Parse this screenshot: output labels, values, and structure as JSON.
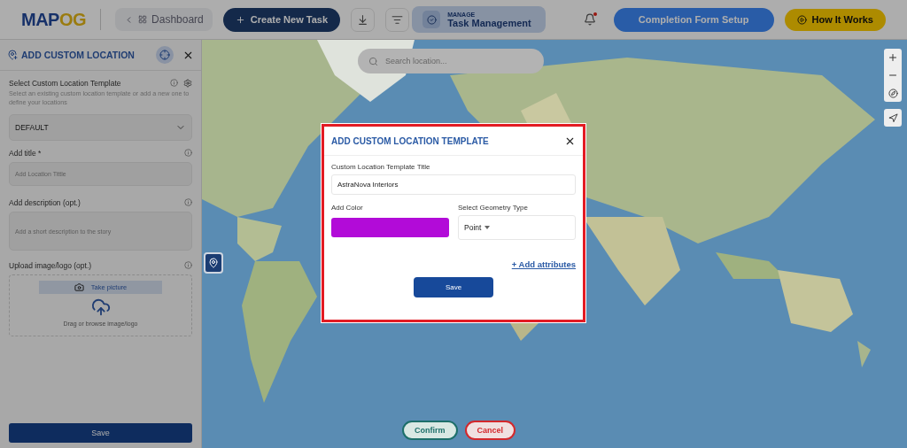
{
  "header": {
    "logo": [
      "MAP",
      "OG"
    ],
    "back_link": "Dashboard",
    "create_button": "Create New Task",
    "manage": {
      "caption": "MANAGE",
      "title": "Task Management"
    },
    "notification_unread": true,
    "setup_button": "Completion Form Setup",
    "help_button": "How It Works"
  },
  "sidebar": {
    "title": "ADD CUSTOM LOCATION",
    "template": {
      "label": "Select Custom Location Template",
      "hint": "Select an existing custom location template or add a new one to define your locations",
      "value": "DEFAULT"
    },
    "title_field": {
      "label": "Add title *",
      "placeholder": "Add Location Tittle"
    },
    "description_field": {
      "label": "Add description (opt.)",
      "placeholder": "Add a short description to the story"
    },
    "upload": {
      "label": "Upload image/logo (opt.)",
      "camera_button": "Take picture",
      "drop_hint": "Drag or browse image/logo"
    },
    "save_button": "Save"
  },
  "map": {
    "search": {
      "placeholder": "Search location..."
    },
    "confirm_button": "Confirm",
    "cancel_button": "Cancel"
  },
  "dialog": {
    "title": "ADD CUSTOM LOCATION TEMPLATE",
    "title_field": {
      "label": "Custom Location Template Title",
      "value": "AstraNova Interiors"
    },
    "color_field": {
      "label": "Add Color",
      "color": "#b20bd8"
    },
    "geometry_field": {
      "label": "Select Geometry Type",
      "value": "Point"
    },
    "add_link": "+ Add attributes",
    "save_button": "Save"
  }
}
